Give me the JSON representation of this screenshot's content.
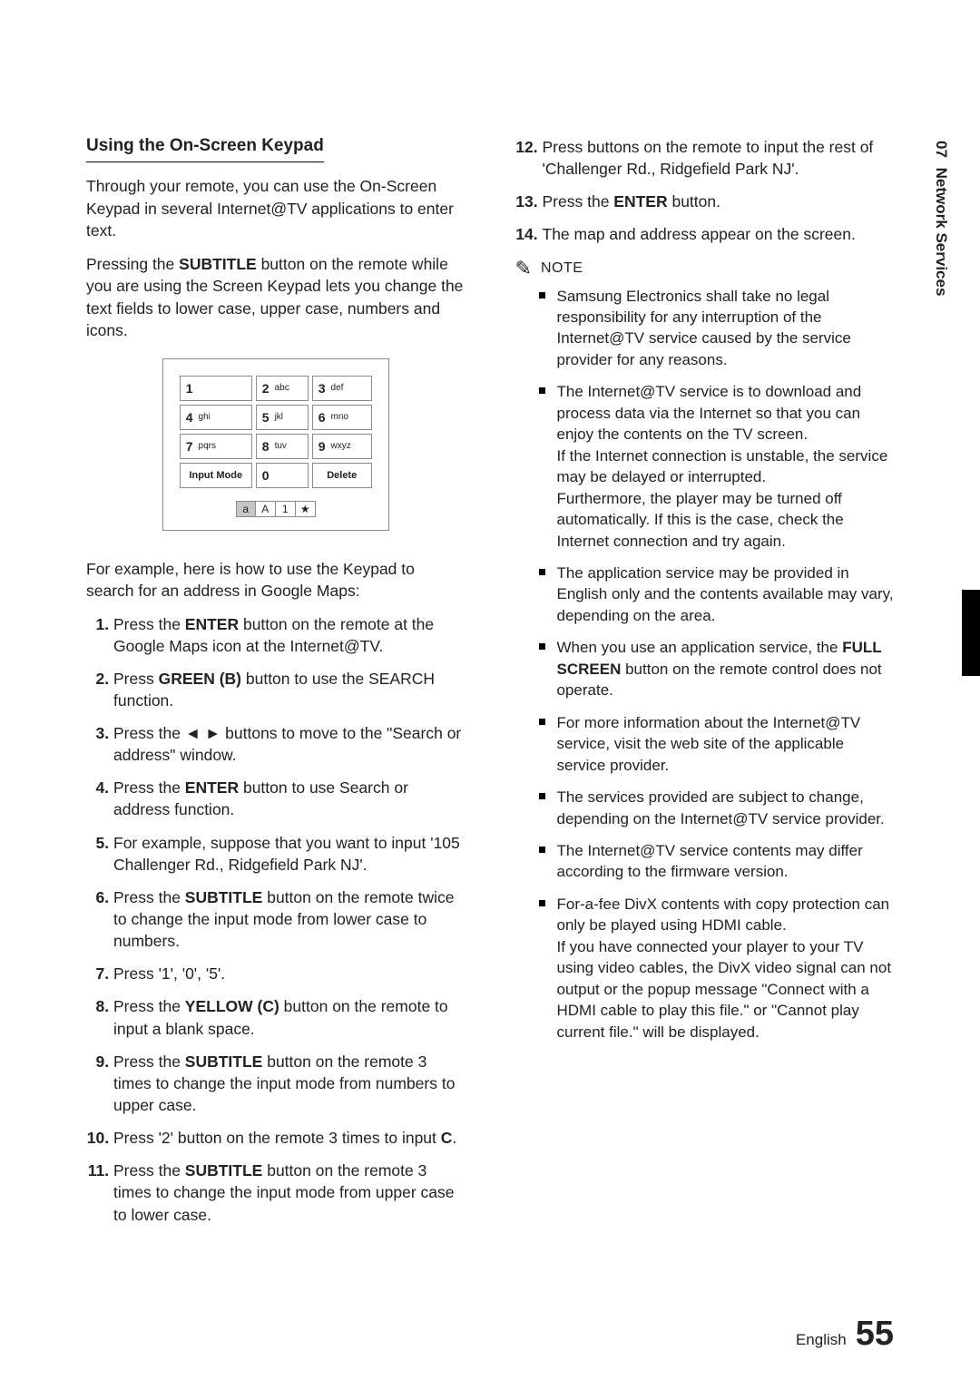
{
  "side": {
    "chapter": "07",
    "title": "Network Services"
  },
  "footer": {
    "lang": "English",
    "page": "55"
  },
  "left": {
    "heading": "Using the On-Screen Keypad",
    "p1": "Through your remote, you can use the On-Screen Keypad in several Internet@TV applications to enter text.",
    "p2_a": "Pressing the ",
    "p2_b": "SUBTITLE",
    "p2_c": " button on the remote while you are using the Screen Keypad lets you change the text fields to lower case, upper case, numbers and icons.",
    "keypad": {
      "rows": [
        [
          {
            "n": "1",
            "s": ""
          },
          {
            "n": "2",
            "s": "abc"
          },
          {
            "n": "3",
            "s": "def"
          }
        ],
        [
          {
            "n": "4",
            "s": "ghi"
          },
          {
            "n": "5",
            "s": "jkl"
          },
          {
            "n": "6",
            "s": "mno"
          }
        ],
        [
          {
            "n": "7",
            "s": "pqrs"
          },
          {
            "n": "8",
            "s": "tuv"
          },
          {
            "n": "9",
            "s": "wxyz"
          }
        ]
      ],
      "bottom": [
        {
          "label": "Input Mode"
        },
        {
          "n": "0",
          "s": ""
        },
        {
          "label": "Delete"
        }
      ],
      "modes": [
        "a",
        "A",
        "1",
        "★"
      ]
    },
    "p3": "For example, here is how to use the Keypad to search for an address in Google Maps:",
    "steps": {
      "s1a": "Press the ",
      "s1b": "ENTER",
      "s1c": " button on the remote at the Google Maps icon at the Internet@TV.",
      "s2a": "Press ",
      "s2b": "GREEN (B)",
      "s2c": " button to use the SEARCH function.",
      "s3a": "Press the ◄ ► buttons to move to the \"Search or address\" window.",
      "s4a": "Press the ",
      "s4b": "ENTER",
      "s4c": " button to use Search or address function.",
      "s5": "For example, suppose that you want to input '105 Challenger Rd., Ridgefield Park NJ'.",
      "s6a": "Press the ",
      "s6b": "SUBTITLE",
      "s6c": " button on the remote twice to change the input mode from lower case to numbers.",
      "s7": "Press '1', '0', '5'.",
      "s8a": "Press the ",
      "s8b": "YELLOW (C)",
      "s8c": " button on the remote to input a blank space.",
      "s9a": "Press the ",
      "s9b": "SUBTITLE",
      "s9c": " button on the remote 3 times to change the input mode from numbers to upper case.",
      "s10a": "Press '2' button on the remote 3 times to input ",
      "s10b": "C",
      "s10c": ".",
      "s11a": "Press the ",
      "s11b": "SUBTITLE",
      "s11c": " button on the remote 3 times to change the input mode from upper case to lower case."
    }
  },
  "right": {
    "steps": {
      "s12": "Press buttons on the remote to input the rest of 'Challenger Rd., Ridgefield Park NJ'.",
      "s13a": "Press the ",
      "s13b": "ENTER",
      "s13c": " button.",
      "s14": "The map and address appear on the screen."
    },
    "note_label": "NOTE",
    "bullets": {
      "b1": "Samsung Electronics shall take no legal responsibility for any interruption of the Internet@TV service caused by the service provider for any reasons.",
      "b2": "The Internet@TV service is to download and process data via the Internet so that you can enjoy the contents on the TV screen.\nIf the Internet connection is unstable, the service may be delayed or interrupted.\nFurthermore, the player may be turned off automatically. If this is the case, check the Internet connection and try again.",
      "b3": "The application service may be provided in English only and the contents available may vary, depending on the area.",
      "b4a": "When you use an application service, the ",
      "b4b": "FULL SCREEN",
      "b4c": " button on the remote control does not operate.",
      "b5": "For more information about the Internet@TV service, visit the web site of the applicable service provider.",
      "b6": "The services provided are subject to change, depending on the Internet@TV service provider.",
      "b7": "The Internet@TV service contents may differ according to the firmware version.",
      "b8": "For-a-fee DivX contents with copy protection can only be played using HDMI cable.\nIf you have connected your player to your TV using video cables, the DivX video signal can not output or the popup message \"Connect with a HDMI cable to play this file.\" or \"Cannot play current file.\" will be displayed."
    }
  }
}
